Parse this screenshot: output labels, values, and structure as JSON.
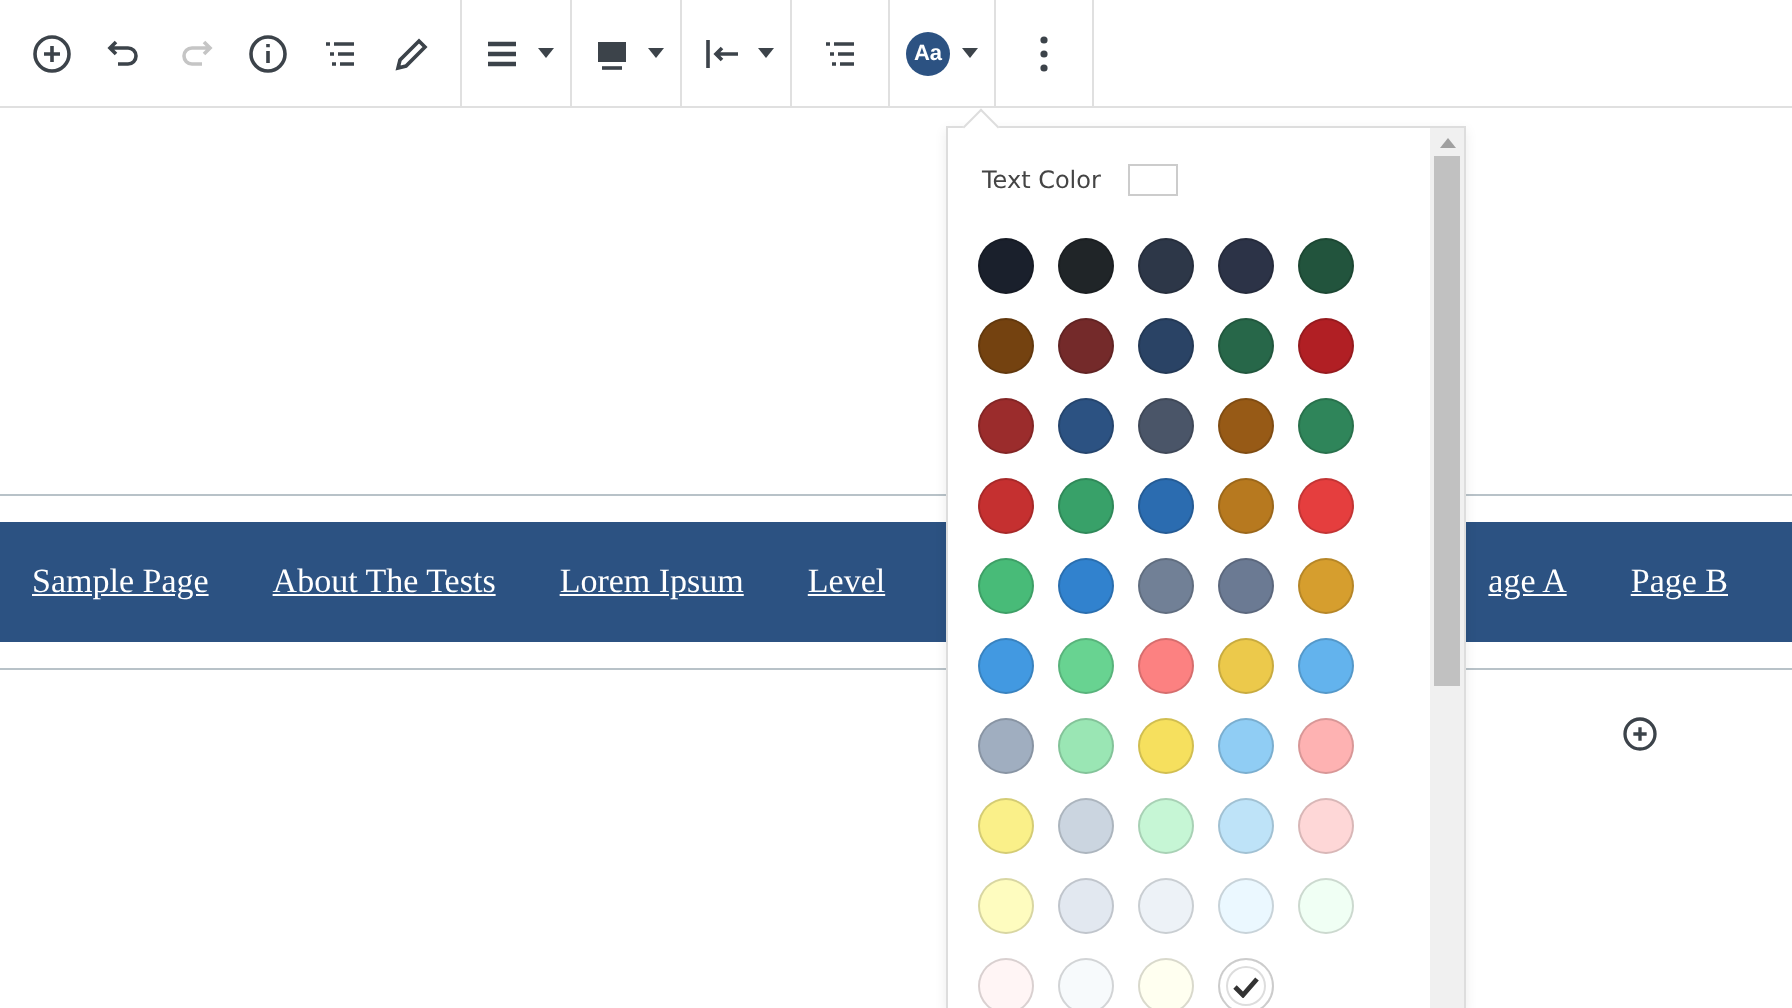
{
  "toolbar": {
    "groups": [
      {
        "items": [
          {
            "kind": "add",
            "disabled": false
          },
          {
            "kind": "undo",
            "disabled": false
          },
          {
            "kind": "redo",
            "disabled": true
          },
          {
            "kind": "info",
            "disabled": false
          },
          {
            "kind": "outline",
            "disabled": false
          },
          {
            "kind": "edit",
            "disabled": false
          }
        ]
      },
      {
        "items": [
          {
            "kind": "menu"
          }
        ]
      },
      {
        "items": [
          {
            "kind": "block"
          }
        ]
      },
      {
        "items": [
          {
            "kind": "align"
          }
        ]
      },
      {
        "items": [
          {
            "kind": "outline"
          }
        ]
      },
      {
        "items": [
          {
            "kind": "text",
            "label": "Aa"
          }
        ]
      },
      {
        "items": [
          {
            "kind": "more"
          }
        ]
      }
    ]
  },
  "nav": {
    "left": [
      "Sample Page",
      "About The Tests",
      "Lorem Ipsum",
      "Level"
    ],
    "right": [
      "age A",
      "Page B"
    ]
  },
  "popover": {
    "label": "Text Color",
    "colors": [
      {
        "color": "#1a202c",
        "selected": false
      },
      {
        "color": "#202528",
        "selected": false
      },
      {
        "color": "#2d3748",
        "selected": false
      },
      {
        "color": "#2c3347",
        "selected": false
      },
      {
        "color": "#22543d",
        "selected": false
      },
      {
        "color": "#744210",
        "selected": false
      },
      {
        "color": "#742a2a",
        "selected": false
      },
      {
        "color": "#2a4365",
        "selected": false
      },
      {
        "color": "#276749",
        "selected": false
      },
      {
        "color": "#b11f24",
        "selected": false
      },
      {
        "color": "#9b2c2c",
        "selected": false
      },
      {
        "color": "#2c5282",
        "selected": false
      },
      {
        "color": "#4a5568",
        "selected": false
      },
      {
        "color": "#975a16",
        "selected": false
      },
      {
        "color": "#2f855a",
        "selected": false
      },
      {
        "color": "#c53030",
        "selected": false
      },
      {
        "color": "#38a169",
        "selected": false
      },
      {
        "color": "#2b6cb0",
        "selected": false
      },
      {
        "color": "#b7791f",
        "selected": false
      },
      {
        "color": "#e53e3e",
        "selected": false
      },
      {
        "color": "#48bb78",
        "selected": false
      },
      {
        "color": "#3182ce",
        "selected": false
      },
      {
        "color": "#718096",
        "selected": false
      },
      {
        "color": "#6b7a93",
        "selected": false
      },
      {
        "color": "#d69e2e",
        "selected": false
      },
      {
        "color": "#4299e1",
        "selected": false
      },
      {
        "color": "#68d391",
        "selected": false
      },
      {
        "color": "#fc8181",
        "selected": false
      },
      {
        "color": "#ecc94b",
        "selected": false
      },
      {
        "color": "#63b3ed",
        "selected": false
      },
      {
        "color": "#a0aec0",
        "selected": false
      },
      {
        "color": "#9ae6b4",
        "selected": false
      },
      {
        "color": "#f6e05e",
        "selected": false
      },
      {
        "color": "#90cdf4",
        "selected": false
      },
      {
        "color": "#feb2b2",
        "selected": false
      },
      {
        "color": "#faf089",
        "selected": false
      },
      {
        "color": "#cbd5e0",
        "selected": false
      },
      {
        "color": "#c6f6d5",
        "selected": false
      },
      {
        "color": "#bee3f8",
        "selected": false
      },
      {
        "color": "#fed7d7",
        "selected": false
      },
      {
        "color": "#fefcbf",
        "selected": false
      },
      {
        "color": "#e2e8f0",
        "selected": false
      },
      {
        "color": "#edf2f7",
        "selected": false
      },
      {
        "color": "#ebf8ff",
        "selected": false
      },
      {
        "color": "#f0fff4",
        "selected": false
      },
      {
        "color": "#fff5f5",
        "selected": false
      },
      {
        "color": "#f7fafc",
        "selected": false
      },
      {
        "color": "#fffff0",
        "selected": false
      },
      {
        "color": "#ffffff",
        "selected": true
      }
    ]
  }
}
